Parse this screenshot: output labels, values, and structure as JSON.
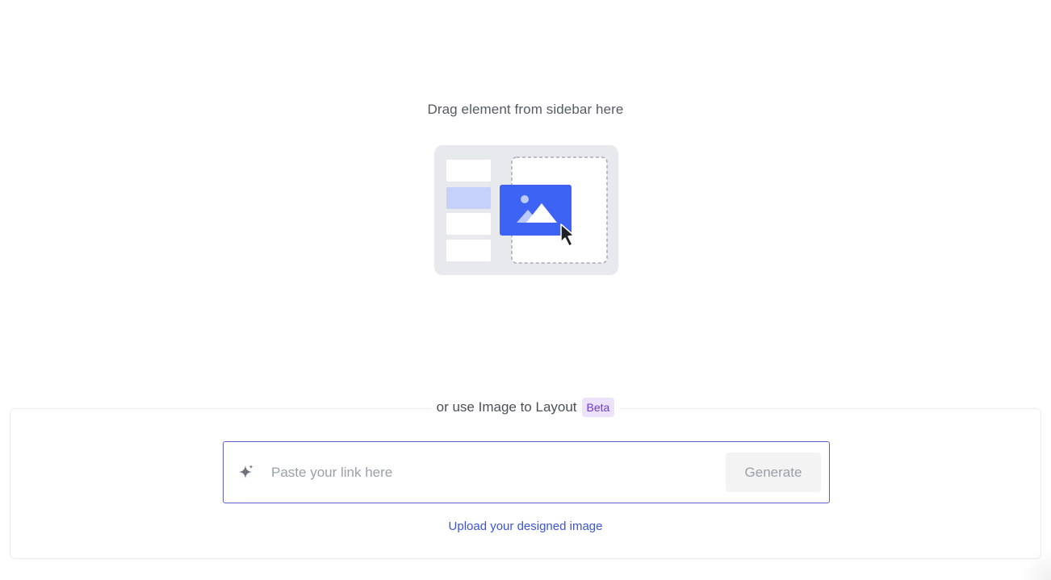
{
  "canvas": {
    "drop_hint": "Drag element from sidebar here"
  },
  "illustration": {
    "icon": "drag-image-to-dropzone-illustration",
    "colors": {
      "frame": "#e8e9ed",
      "sidebar_item": "#ffffff",
      "sidebar_item_active": "#c5d1fb",
      "dropzone_border": "#a6a9bd",
      "image_card": "#3d63f5",
      "cursor": "#1f2328"
    }
  },
  "image_to_layout": {
    "heading": "or use Image to Layout",
    "badge": "Beta",
    "input_placeholder": "Paste your link here",
    "input_value": "",
    "generate_label": "Generate",
    "upload_label": "Upload your designed image",
    "sparkle_icon": "sparkle-icon"
  },
  "colors": {
    "accent": "#5a5fd1",
    "link": "#3a55d8",
    "badge_text": "#6b39d6",
    "badge_bg": "#ece2fb"
  }
}
